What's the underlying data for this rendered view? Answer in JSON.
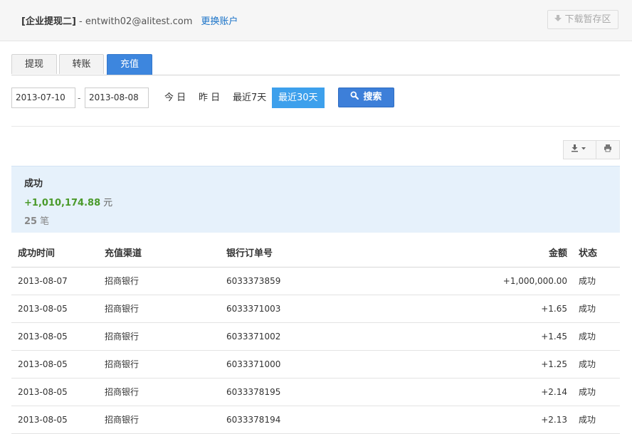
{
  "header": {
    "account_name": "[企业提现二]",
    "separator": " - ",
    "email": "entwith02@alitest.com",
    "switch_account": "更换账户",
    "download_temp": "下载暂存区"
  },
  "tabs": [
    {
      "label": "提现",
      "active": false
    },
    {
      "label": "转账",
      "active": false
    },
    {
      "label": "充值",
      "active": true
    }
  ],
  "filter": {
    "start_date": "2013-07-10",
    "date_separator": "-",
    "end_date": "2013-08-08",
    "quick_ranges": [
      "今 日",
      "昨 日",
      "最近7天",
      "最近30天"
    ],
    "selected_range": "最近30天",
    "search_label": "搜索"
  },
  "summary": {
    "title": "成功",
    "amount": "+1,010,174.88",
    "amount_unit": "元",
    "count": "25",
    "count_unit": "笔"
  },
  "table": {
    "columns": [
      "成功时间",
      "充值渠道",
      "银行订单号",
      "金额",
      "状态"
    ],
    "rows": [
      {
        "time": "2013-08-07",
        "channel": "招商银行",
        "order": "6033373859",
        "amount": "+1,000,000.00",
        "status": "成功"
      },
      {
        "time": "2013-08-05",
        "channel": "招商银行",
        "order": "6033371003",
        "amount": "+1.65",
        "status": "成功"
      },
      {
        "time": "2013-08-05",
        "channel": "招商银行",
        "order": "6033371002",
        "amount": "+1.45",
        "status": "成功"
      },
      {
        "time": "2013-08-05",
        "channel": "招商银行",
        "order": "6033371000",
        "amount": "+1.25",
        "status": "成功"
      },
      {
        "time": "2013-08-05",
        "channel": "招商银行",
        "order": "6033378195",
        "amount": "+2.14",
        "status": "成功"
      },
      {
        "time": "2013-08-05",
        "channel": "招商银行",
        "order": "6033378194",
        "amount": "+2.13",
        "status": "成功"
      }
    ]
  },
  "icons": {
    "download_temp": "download-arrow-icon",
    "search": "magnifier-icon",
    "export": "download-dropdown-icon",
    "print": "printer-icon"
  },
  "colors": {
    "primary": "#3d86de",
    "selected_range": "#3da0ec",
    "summary_bg": "#e6f1fb",
    "amount_green": "#4a9a2a",
    "link": "#1a73c8"
  }
}
